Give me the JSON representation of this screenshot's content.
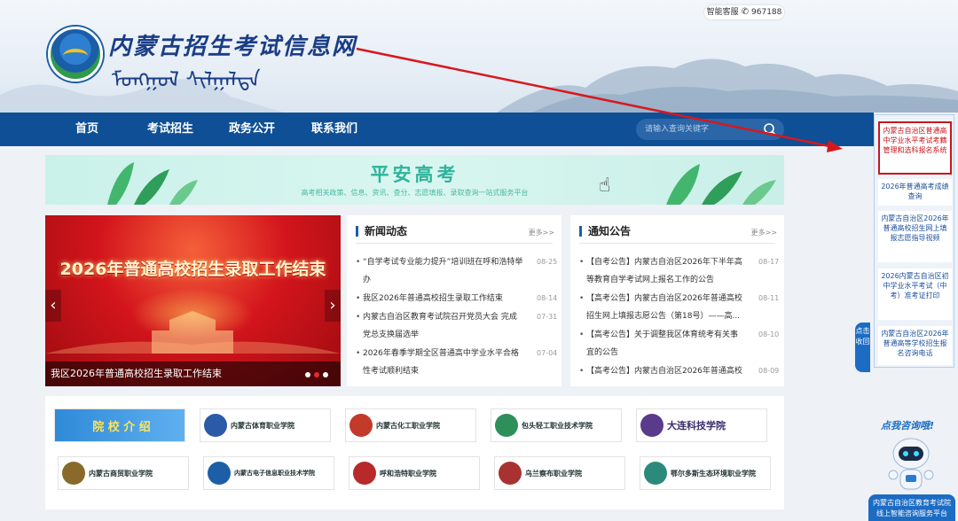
{
  "header": {
    "site_title": "内蒙古招生考试信息网",
    "mongolian_title": "ᠮᠣᠩᠭᠣᠯ ᠰᠢᠯᠭᠠᠯᠲᠠ",
    "service_label": "智能客服",
    "service_number": "967188"
  },
  "nav": {
    "items": [
      "首页",
      "考试招生",
      "政务公开",
      "联系我们"
    ],
    "search_placeholder": "请输入查询关键字"
  },
  "banner": {
    "title": "平安高考",
    "subtitle": "高考相关政策、信息、资讯、查分、志愿填报、录取查询一站式服务平台"
  },
  "slider": {
    "headline": "2026年普通高校招生录取工作结束",
    "caption": "我区2026年普通高校招生录取工作结束"
  },
  "news": {
    "title": "新闻动态",
    "more": "更多>>",
    "items": [
      {
        "line1": "“自学考试专业能力提升”培训班在呼和浩特举",
        "line2": "办",
        "date": "08-25"
      },
      {
        "line1": "我区2026年普通高校招生录取工作结束",
        "line2": "",
        "date": "08-14"
      },
      {
        "line1": "内蒙古自治区教育考试院召开党员大会 完成",
        "line2": "党总支换届选举",
        "date": "07-31"
      },
      {
        "line1": "2026年春季学期全区普通高中学业水平合格",
        "line2": "性考试顺利结束",
        "date": "07-04"
      }
    ]
  },
  "notices": {
    "title": "通知公告",
    "more": "更多>>",
    "items": [
      {
        "line1": "【自考公告】内蒙古自治区2026年下半年高",
        "line2": "等教育自学考试网上报名工作的公告",
        "date": "08-17"
      },
      {
        "line1": "【高考公告】内蒙古自治区2026年普通高校",
        "line2": "招生网上填报志愿公告（第18号）——高...",
        "date": "08-11"
      },
      {
        "line1": "【高考公告】关于调整我区体育统考有关事",
        "line2": "宜的公告",
        "date": "08-10"
      },
      {
        "line1": "【高考公告】内蒙古自治区2026年普通高校",
        "line2": "",
        "date": "08-09"
      }
    ]
  },
  "colleges": [
    {
      "name": "院 校 介 绍"
    },
    {
      "name": "内蒙古体育职业学院"
    },
    {
      "name": "内蒙古化工职业学院"
    },
    {
      "name": "包头轻工职业技术学院"
    },
    {
      "name": "大连科技学院"
    },
    {
      "name": "内蒙古商贸职业学院"
    },
    {
      "name": "内蒙古电子信息职业技术学院"
    },
    {
      "name": "呼和浩特职业学院"
    },
    {
      "name": "乌兰察布职业学院"
    },
    {
      "name": "鄂尔多斯生态环境职业学院"
    }
  ],
  "sidebar": {
    "items": [
      "内蒙古自治区普通高中学业水平考试考籍管理和选科报名系统",
      "2026年普通高考成绩查询",
      "内蒙古自治区2026年普通高校招生网上填报志愿指导视频",
      "2026内蒙古自治区初中学业水平考试（中考）准考证打印",
      "内蒙古自治区2026年普通高等学校招生报名咨询电话"
    ],
    "fold_label": "点击收回"
  },
  "consult": {
    "title": "点我咨询哦!",
    "box_line1": "内蒙古自治区教育考试院",
    "box_line2": "线上智能咨询服务平台"
  },
  "colors": {
    "nav": "#0e4f95",
    "accent_red": "#c9161c",
    "brand_green": "#2eb39a"
  }
}
